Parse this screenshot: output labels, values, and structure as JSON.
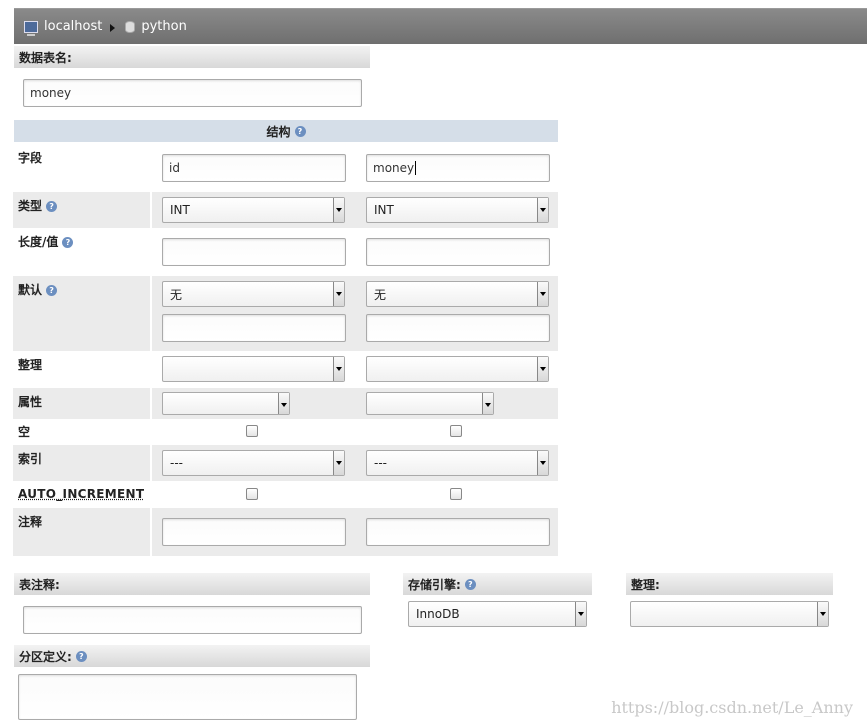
{
  "breadcrumb": {
    "server": "localhost",
    "database": "python"
  },
  "table_name": {
    "label": "数据表名:",
    "value": "money"
  },
  "structure": {
    "header": "结构",
    "rows": {
      "field": "字段",
      "type": "类型",
      "length": "长度/值",
      "default": "默认",
      "collation": "整理",
      "attributes": "属性",
      "null": "空",
      "index": "索引",
      "auto_increment": "AUTO_INCREMENT",
      "comment": "注释"
    },
    "columns": [
      {
        "field": "id",
        "type": "INT",
        "default": "无",
        "index": "---"
      },
      {
        "field": "money",
        "type": "INT",
        "default": "无",
        "index": "---"
      }
    ]
  },
  "table_comment": {
    "label": "表注释:"
  },
  "storage_engine": {
    "label": "存储引擎:",
    "value": "InnoDB"
  },
  "collation": {
    "label": "整理:"
  },
  "partition": {
    "label": "分区定义:"
  },
  "watermark": "https://blog.csdn.net/Le_Anny"
}
